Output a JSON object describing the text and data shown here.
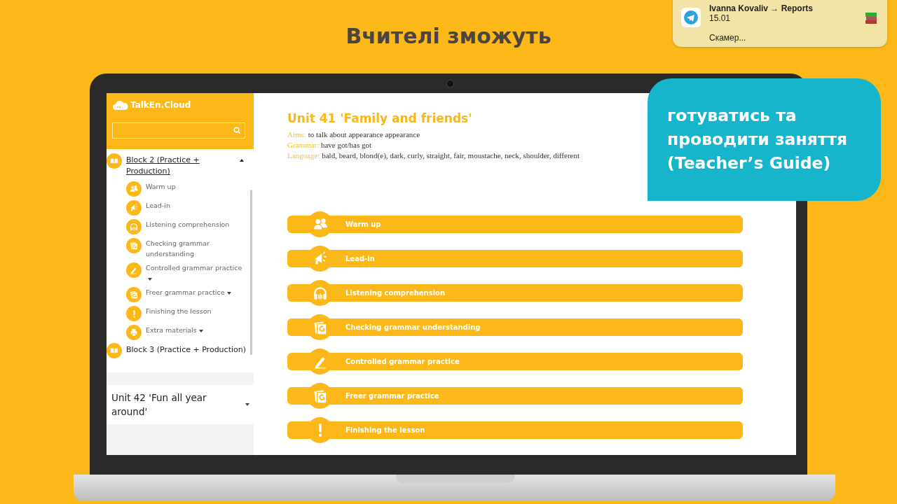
{
  "heading": "Вчителі зможуть",
  "notification": {
    "sender": "Ivanna Kovaliv → Reports",
    "time": "15.01",
    "message": "Скамер..."
  },
  "callout": "готуватись та проводити заняття (Teacher’s Guide)",
  "app": {
    "logo": "TalkEn.Cloud",
    "sidebar": {
      "blocks": [
        {
          "label": "Block 2 (Practice + Production)",
          "selected": true,
          "expanded": true,
          "children": [
            {
              "label": "Warm up",
              "kind": "people",
              "has_menu": false
            },
            {
              "label": "Lead-in",
              "kind": "megaphone",
              "has_menu": false
            },
            {
              "label": "Listening comprehension",
              "kind": "headphones",
              "has_menu": false
            },
            {
              "label": "Checking grammar understanding",
              "kind": "grammar",
              "has_menu": false
            },
            {
              "label": "Controlled grammar practice",
              "kind": "pencil",
              "has_menu": true
            },
            {
              "label": "Freer grammar practice",
              "kind": "grammar",
              "has_menu": true
            },
            {
              "label": "Finishing the lesson",
              "kind": "exclamation",
              "has_menu": false
            },
            {
              "label": "Extra materials",
              "kind": "printer",
              "has_menu": true
            }
          ]
        },
        {
          "label": "Block 3 (Practice + Production)",
          "selected": false,
          "expanded": false
        }
      ],
      "units": [
        {
          "label": "Unit 42 'Fun all year around'",
          "expanded": false
        }
      ]
    },
    "lesson": {
      "title": "Unit 41 'Family and friends'",
      "fields": [
        {
          "label": "Aims:",
          "text": "to talk about appearance appearance"
        },
        {
          "label": "Grammar:",
          "text": "have got/has got"
        },
        {
          "label": "Language:",
          "text": "bald, beard, blond(e), dark, curly, straight, fair, moustache, neck, shoulder, different"
        }
      ],
      "activities": [
        {
          "label": "Warm up",
          "kind": "people"
        },
        {
          "label": "Lead-in",
          "kind": "megaphone"
        },
        {
          "label": "Listening comprehension",
          "kind": "headphones"
        },
        {
          "label": "Checking grammar understanding",
          "kind": "grammar"
        },
        {
          "label": "Controlled grammar practice",
          "kind": "pencil"
        },
        {
          "label": "Freer grammar practice",
          "kind": "grammar"
        },
        {
          "label": "Finishing the lesson",
          "kind": "exclamation"
        }
      ]
    }
  }
}
